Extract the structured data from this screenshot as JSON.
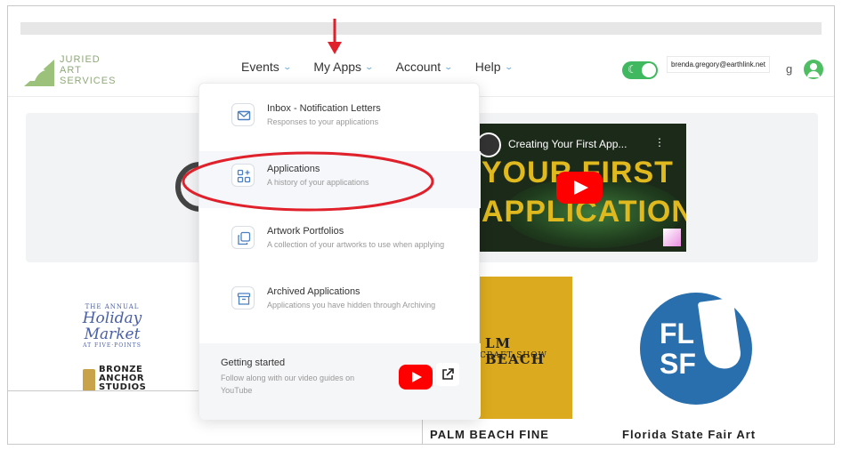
{
  "logo": {
    "line1": "JURIED",
    "line2": "ART",
    "line3": "SERVICES"
  },
  "nav": {
    "items": [
      {
        "label": "Events"
      },
      {
        "label": "My Apps"
      },
      {
        "label": "Account"
      },
      {
        "label": "Help"
      }
    ]
  },
  "header": {
    "user_email": "brenda.gregory@earthlink.net",
    "user_fragment": "g"
  },
  "dropdown": {
    "items": [
      {
        "title": "Inbox - Notification Letters",
        "subtitle": "Responses to your applications",
        "icon": "mail-icon"
      },
      {
        "title": "Applications",
        "subtitle": "A history of your applications",
        "icon": "grid-plus-icon"
      },
      {
        "title": "Artwork Portfolios",
        "subtitle": "A collection of your artworks to use when applying",
        "icon": "copy-icon"
      },
      {
        "title": "Archived Applications",
        "subtitle": "Applications you have hidden through Archiving",
        "icon": "archive-icon"
      }
    ],
    "footer": {
      "title": "Getting started",
      "subtitle": "Follow along with our video guides on YouTube"
    }
  },
  "video": {
    "title": "Creating Your First App...",
    "big_line1": "YOUR FIRST",
    "big_line2": "APPLICATION"
  },
  "events": {
    "holiday": {
      "line1": "THE ANNUAL",
      "line2a": "Holiday",
      "line2b": "Market",
      "line3": "AT FIVE·POINTS"
    },
    "bronze": {
      "line1": "BRONZE",
      "line2": "ANCHOR",
      "line3": "STUDIOS"
    },
    "palm": {
      "line1": "LM BEACH",
      "line2": "CRAFT SHOW",
      "caption": "PALM BEACH FINE"
    },
    "flsf": {
      "line1": "FL",
      "line2": "SF",
      "caption": "Florida State Fair Art"
    }
  },
  "colors": {
    "accent_green": "#3fb860",
    "annotation_red": "#e0202a",
    "nav_chevron": "#5aa0d8"
  }
}
